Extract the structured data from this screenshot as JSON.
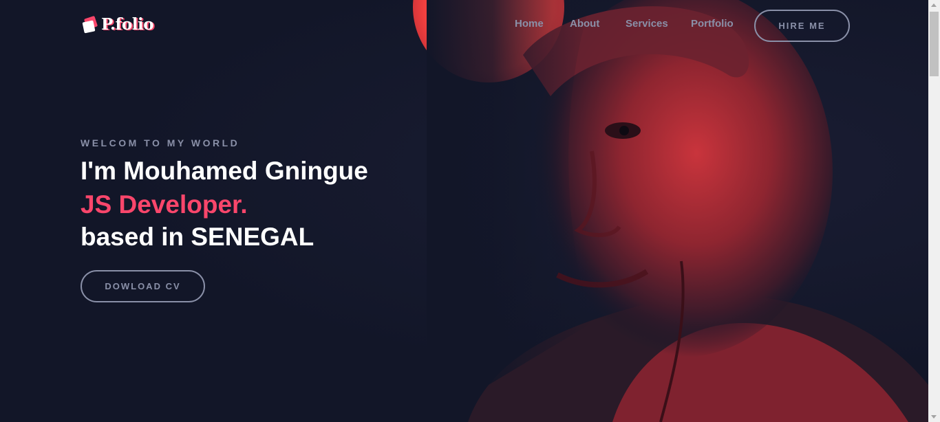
{
  "brand": {
    "logo_text": "P.folio"
  },
  "nav": {
    "items": [
      {
        "label": "Home"
      },
      {
        "label": "About"
      },
      {
        "label": "Services"
      },
      {
        "label": "Portfolio"
      }
    ],
    "cta_label": "HIRE ME"
  },
  "hero": {
    "eyebrow": "WELCOM TO MY WORLD",
    "headline_line1": "I'm Mouhamed Gningue",
    "headline_role": "JS Developer.",
    "headline_line3": "based in SENEGAL",
    "cv_button_label": "DOWLOAD CV"
  },
  "colors": {
    "background": "#121628",
    "accent": "#f9466b",
    "muted_text": "#8a90a8",
    "photo_tint": "#d8333f"
  },
  "icons": {
    "logo": "logo-squares-icon"
  }
}
